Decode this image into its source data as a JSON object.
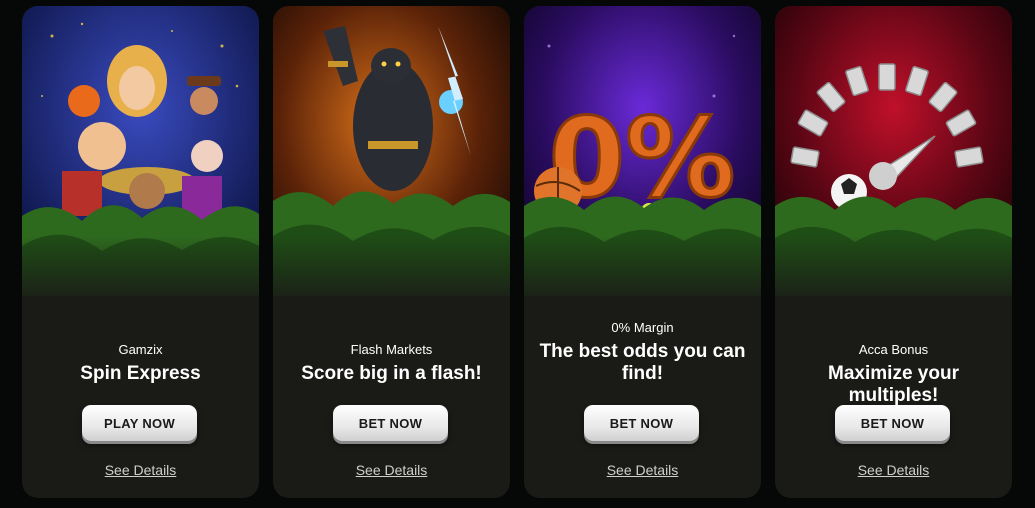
{
  "cards": [
    {
      "subtitle": "Gamzix",
      "headline": "Spin Express",
      "cta": "PLAY NOW",
      "details": "See Details",
      "bg": "#1c2a7a"
    },
    {
      "subtitle": "Flash Markets",
      "headline": "Score big in a flash!",
      "cta": "BET NOW",
      "details": "See Details",
      "bg": "#8a3a06"
    },
    {
      "subtitle": "0% Margin",
      "headline": "The best odds you can find!",
      "cta": "BET NOW",
      "details": "See Details",
      "bg": "#3a1478",
      "art_text": "0%"
    },
    {
      "subtitle": "Acca Bonus",
      "headline": "Maximize your multiples!",
      "cta": "BET NOW",
      "details": "See Details",
      "bg": "#8a0a1c"
    }
  ]
}
